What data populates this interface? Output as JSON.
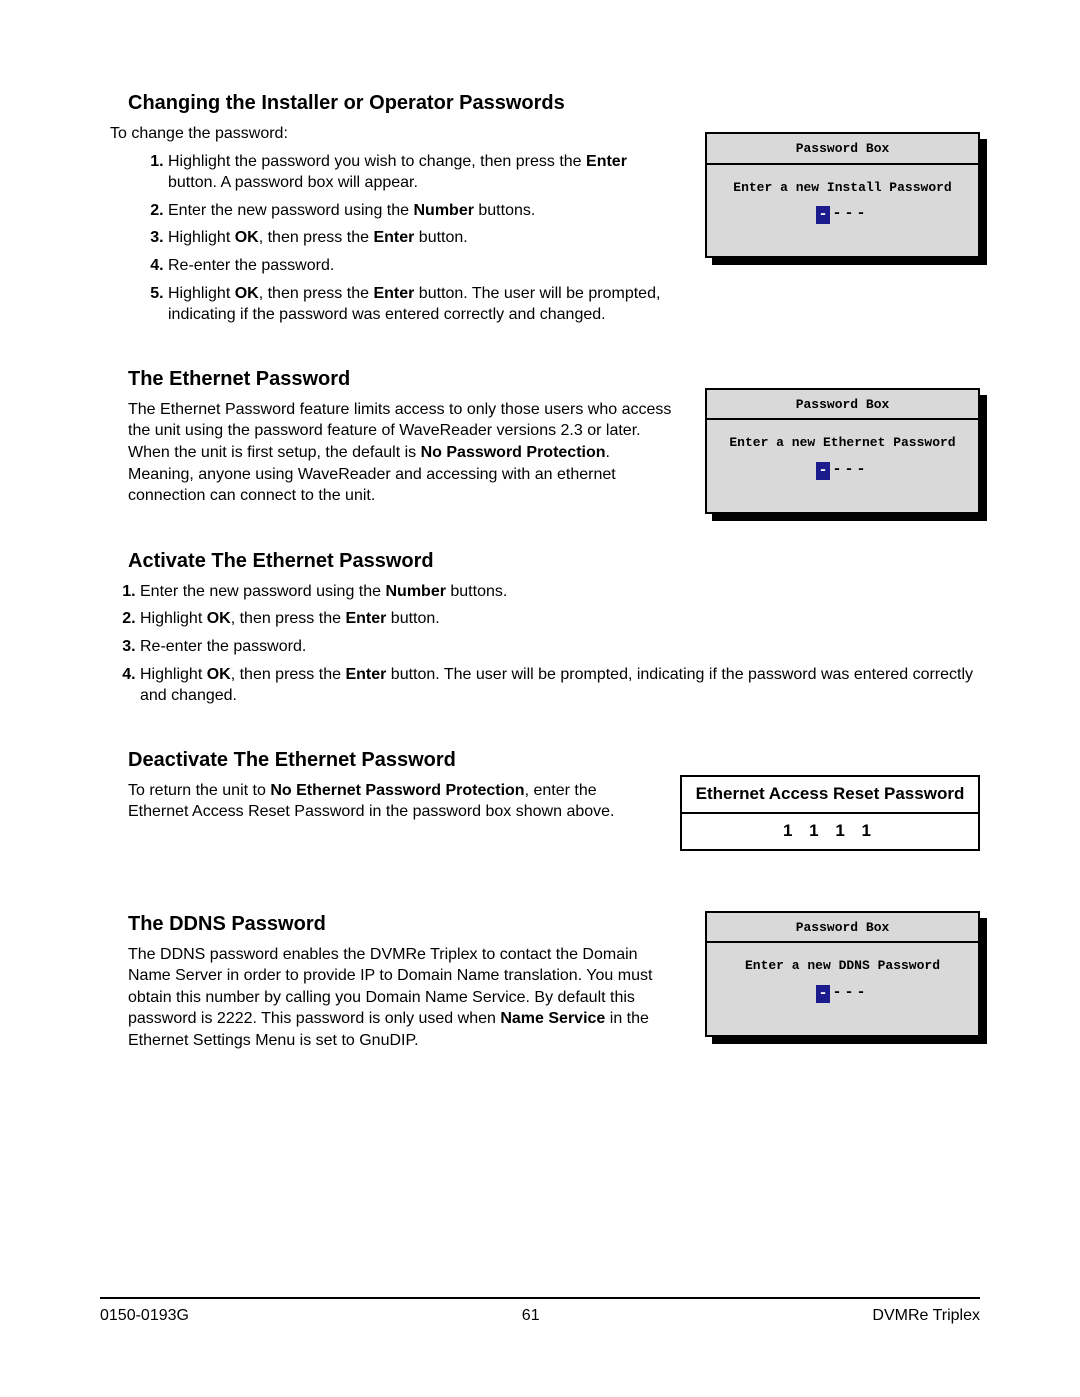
{
  "sections": {
    "changing": {
      "title": "Changing the Installer or Operator Passwords",
      "intro": "To change the password:",
      "steps": [
        {
          "pre": "Highlight the password you wish to change, then press the ",
          "bolds": [
            "Enter"
          ],
          "mids": [
            " button.  A password box will appear."
          ]
        },
        {
          "pre": "Enter the new password using the ",
          "bolds": [
            "Number"
          ],
          "mids": [
            " buttons."
          ]
        },
        {
          "pre": "Highlight ",
          "bolds": [
            "OK",
            "Enter"
          ],
          "mids": [
            ", then press the ",
            " button."
          ]
        },
        {
          "pre": "Re-enter the password."
        },
        {
          "pre": "Highlight ",
          "bolds": [
            "OK",
            "Enter"
          ],
          "mids": [
            ", then press the ",
            " button.  The user will be prompted, indicating if the password was entered correctly and changed."
          ]
        }
      ],
      "box": {
        "title": "Password Box",
        "prompt": "Enter a new Install Password",
        "mask": "---"
      }
    },
    "ethernet": {
      "title": "The Ethernet Password",
      "body_pre": "The Ethernet Password feature limits access to only those users who access the unit using the password feature of WaveReader versions 2.3 or later.  When the unit is first setup, the default is ",
      "body_bold": "No Password Protection",
      "body_post": ".  Meaning, anyone using WaveReader and accessing with an ethernet connection can connect to the unit.",
      "box": {
        "title": "Password Box",
        "prompt": "Enter a new Ethernet Password",
        "mask": "---"
      }
    },
    "activate": {
      "title": "Activate The Ethernet Password",
      "steps": [
        {
          "pre": "Enter the new password using the ",
          "bolds": [
            "Number"
          ],
          "mids": [
            " buttons."
          ]
        },
        {
          "pre": "Highlight ",
          "bolds": [
            "OK",
            "Enter"
          ],
          "mids": [
            ", then press the ",
            " button."
          ]
        },
        {
          "pre": "Re-enter the password."
        },
        {
          "pre": "Highlight ",
          "bolds": [
            "OK",
            "Enter"
          ],
          "mids": [
            ", then press the ",
            " button.  The user will be prompted, indicating if the password was entered correctly and changed."
          ]
        }
      ]
    },
    "deactivate": {
      "title": "Deactivate The Ethernet Password",
      "body_pre": "To return the unit to ",
      "body_bold": "No Ethernet Password Protection",
      "body_post": ", enter the Ethernet Access Reset Password in the password box shown above.",
      "reset": {
        "header": "Ethernet Access Reset Password",
        "value": "1 1 1 1"
      }
    },
    "ddns": {
      "title": "The DDNS Password",
      "body_pre": "The DDNS password enables the DVMRe Triplex to contact the Domain Name Server in order to provide IP to Domain Name translation. You must obtain this number by calling you Domain Name Service. By default this password is 2222. This password is only used when ",
      "body_bold": "Name Service",
      "body_post": " in the Ethernet Settings Menu is set to GnuDIP.",
      "box": {
        "title": "Password Box",
        "prompt": "Enter a new DDNS Password",
        "mask": "---"
      }
    }
  },
  "footer": {
    "left": "0150-0193G",
    "center": "61",
    "right": "DVMRe Triplex"
  }
}
